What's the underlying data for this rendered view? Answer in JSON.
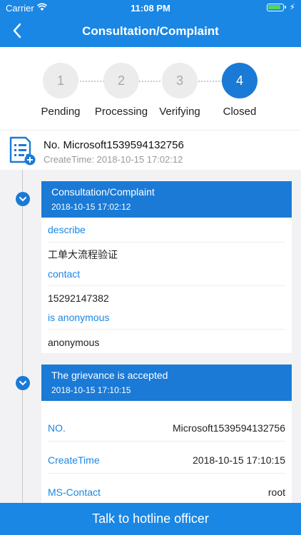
{
  "status_bar": {
    "carrier": "Carrier",
    "time": "11:08 PM"
  },
  "header": {
    "title": "Consultation/Complaint"
  },
  "steps": [
    {
      "number": "1",
      "label": "Pending"
    },
    {
      "number": "2",
      "label": "Processing"
    },
    {
      "number": "3",
      "label": "Verifying"
    },
    {
      "number": "4",
      "label": "Closed"
    }
  ],
  "order": {
    "no": "No. Microsoft1539594132756",
    "create_time": "CreateTime: 2018-10-15 17:02:12"
  },
  "timeline": [
    {
      "title": "Consultation/Complaint",
      "date": "2018-10-15 17:02:12",
      "fields": [
        {
          "label": "describe",
          "value": "工单大流程验证"
        },
        {
          "label": "contact",
          "value": "15292147382"
        },
        {
          "label": "is anonymous",
          "value": "anonymous"
        }
      ]
    },
    {
      "title": "The grievance is accepted",
      "date": "2018-10-15 17:10:15",
      "rows": [
        {
          "label": "NO.",
          "value": "Microsoft1539594132756"
        },
        {
          "label": "CreateTime",
          "value": "2018-10-15 17:10:15"
        },
        {
          "label": "MS-Contact",
          "value": "root"
        }
      ]
    }
  ],
  "bottom_button": "Talk to hotline officer",
  "colors": {
    "primary": "#1a87e5",
    "accent": "#1a7ad6",
    "inactive_step": "#ececec"
  }
}
